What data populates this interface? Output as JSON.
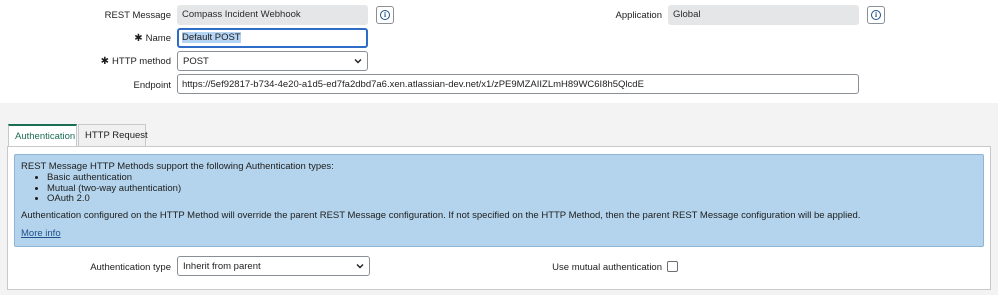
{
  "form": {
    "rest_message": {
      "label": "REST Message",
      "value": "Compass Incident Webhook"
    },
    "application": {
      "label": "Application",
      "value": "Global"
    },
    "name": {
      "required_mark": "✱",
      "label": "Name",
      "value": "Default POST"
    },
    "http_method": {
      "required_mark": "✱",
      "label": "HTTP method",
      "value": "POST"
    },
    "endpoint": {
      "label": "Endpoint",
      "value": "https://5ef92817-b734-4e20-a1d5-ed7fa2dbd7a6.xen.atlassian-dev.net/x1/zPE9MZAIIZLmH89WC6I8h5QlcdE"
    }
  },
  "tabs": [
    {
      "label": "Authentication",
      "active": true
    },
    {
      "label": "HTTP Request",
      "active": false
    }
  ],
  "alert": {
    "intro": "REST Message HTTP Methods support the following Authentication types:",
    "items": [
      "Basic authentication",
      "Mutual (two-way authentication)",
      "OAuth 2.0"
    ],
    "note": "Authentication configured on the HTTP Method will override the parent REST Message configuration. If not specified on the HTTP Method, then the parent REST Message configuration will be applied.",
    "more_info": "More info"
  },
  "auth": {
    "type_label": "Authentication type",
    "type_value": "Inherit from parent",
    "mutual_label": "Use mutual authentication",
    "mutual_checked": false
  },
  "colors": {
    "accent": "#1b6e56",
    "focus": "#2e6cc7",
    "alert_bg": "#b3d4ec",
    "link": "#1f4f8a"
  },
  "icons": {
    "info": "info-icon",
    "dropdown": "chevron-down-icon",
    "required": "asterisk-icon"
  }
}
